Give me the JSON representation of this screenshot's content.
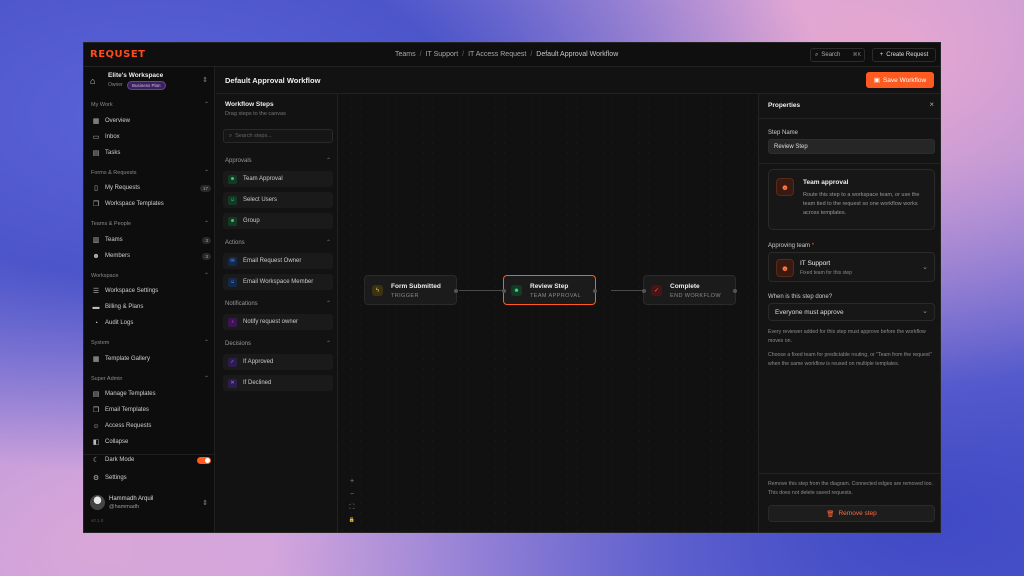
{
  "brand": {
    "logo": "REQUSET"
  },
  "breadcrumb": [
    "Teams",
    "IT Support",
    "IT Access Request",
    "Default Approval Workflow"
  ],
  "topbar": {
    "search_label": "Search",
    "search_kbd": "⌘K",
    "create_label": "Create Request"
  },
  "workspace": {
    "name": "Elite's Workspace",
    "role": "Owner",
    "plan": "Business Plan"
  },
  "sidebar": {
    "my_work": {
      "label": "My Work",
      "items": [
        {
          "label": "Overview"
        },
        {
          "label": "Inbox"
        },
        {
          "label": "Tasks"
        }
      ]
    },
    "forms": {
      "label": "Forms & Requests",
      "items": [
        {
          "label": "My Requests",
          "count": "17"
        },
        {
          "label": "Workspace Templates"
        }
      ]
    },
    "teams": {
      "label": "Teams & People",
      "items": [
        {
          "label": "Teams",
          "count": "3"
        },
        {
          "label": "Members",
          "count": "3"
        }
      ]
    },
    "workspace": {
      "label": "Workspace",
      "items": [
        {
          "label": "Workspace Settings"
        },
        {
          "label": "Billing & Plans"
        },
        {
          "label": "Audit Logs"
        }
      ]
    },
    "system": {
      "label": "System",
      "items": [
        {
          "label": "Template Gallery"
        }
      ]
    },
    "super_admin": {
      "label": "Super Admin",
      "items": [
        {
          "label": "Manage Templates"
        },
        {
          "label": "Email Templates"
        },
        {
          "label": "Access Requests"
        }
      ]
    },
    "bottom": {
      "collapse": "Collapse",
      "dark_mode": "Dark Mode",
      "dark_mode_on": true,
      "settings": "Settings"
    }
  },
  "user": {
    "name": "Hammadh Arquil",
    "handle": "@hammadh"
  },
  "version": "v0.1.0",
  "main": {
    "title": "Default Approval Workflow",
    "save_label": "Save Workflow"
  },
  "steps_panel": {
    "title": "Workflow Steps",
    "subtitle": "Drag steps to the canvas",
    "search_placeholder": "Search steps...",
    "groups": {
      "approvals": {
        "label": "Approvals",
        "items": [
          "Team Approval",
          "Select Users",
          "Group"
        ]
      },
      "actions": {
        "label": "Actions",
        "items": [
          "Email Request Owner",
          "Email Workspace Member"
        ]
      },
      "notifications": {
        "label": "Notifications",
        "items": [
          "Notify request owner"
        ]
      },
      "decisions": {
        "label": "Decisions",
        "items": [
          "If Approved",
          "If Declined"
        ]
      }
    }
  },
  "canvas": {
    "nodes": [
      {
        "title": "Form Submitted",
        "subtitle": "TRIGGER"
      },
      {
        "title": "Review Step",
        "subtitle": "TEAM APPROVAL"
      },
      {
        "title": "Complete",
        "subtitle": "END WORKFLOW"
      }
    ],
    "zoom_controls": [
      "+",
      "−",
      "⛶",
      "🔒"
    ]
  },
  "properties": {
    "title": "Properties",
    "step_name_label": "Step Name",
    "step_name_value": "Review Step",
    "card_title": "Team approval",
    "card_desc": "Route this step to a workspace team, or use the team tied to the request so one workflow works across templates.",
    "approving_team_label": "Approving team",
    "approving_team_value": "IT Support",
    "approving_team_sub": "Fixed team for this step",
    "done_label": "When is this step done?",
    "done_value": "Everyone must approve",
    "help1": "Every reviewer added for this step must approve before the workflow moves on.",
    "help2": "Choose a fixed team for predictable routing, or \"Team from the request\" when the same workflow is reused on multiple templates.",
    "remove_note": "Remove this step from the diagram. Connected edges are removed too. This does not delete saved requests.",
    "remove_label": "Remove step"
  },
  "colors": {
    "accent": "#ff5a1f",
    "background": "#121212"
  }
}
